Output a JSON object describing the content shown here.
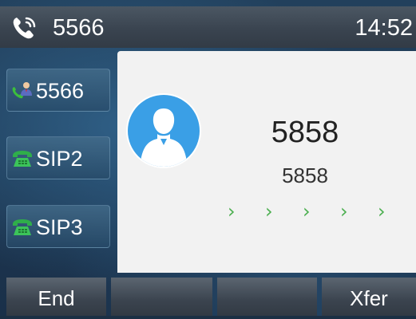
{
  "status_bar": {
    "account": "5566",
    "time": "14:52",
    "phone_icon": "handset-icon"
  },
  "line_keys": [
    {
      "label": "5566",
      "icon": "contact-handset-icon"
    },
    {
      "label": "SIP2",
      "icon": "green-phone-icon"
    },
    {
      "label": "SIP3",
      "icon": "green-phone-icon"
    }
  ],
  "call": {
    "name": "5858",
    "number": "5858",
    "avatar_icon": "person-avatar-icon",
    "progress_indicator": "› › › › ›"
  },
  "softkeys": [
    "End",
    "",
    "",
    "Xfer"
  ],
  "colors": {
    "status_bar": "#3a4450",
    "panel": "#f2f2f2",
    "avatar_blue": "#3a9fe6",
    "progress_green": "#4caf50"
  }
}
